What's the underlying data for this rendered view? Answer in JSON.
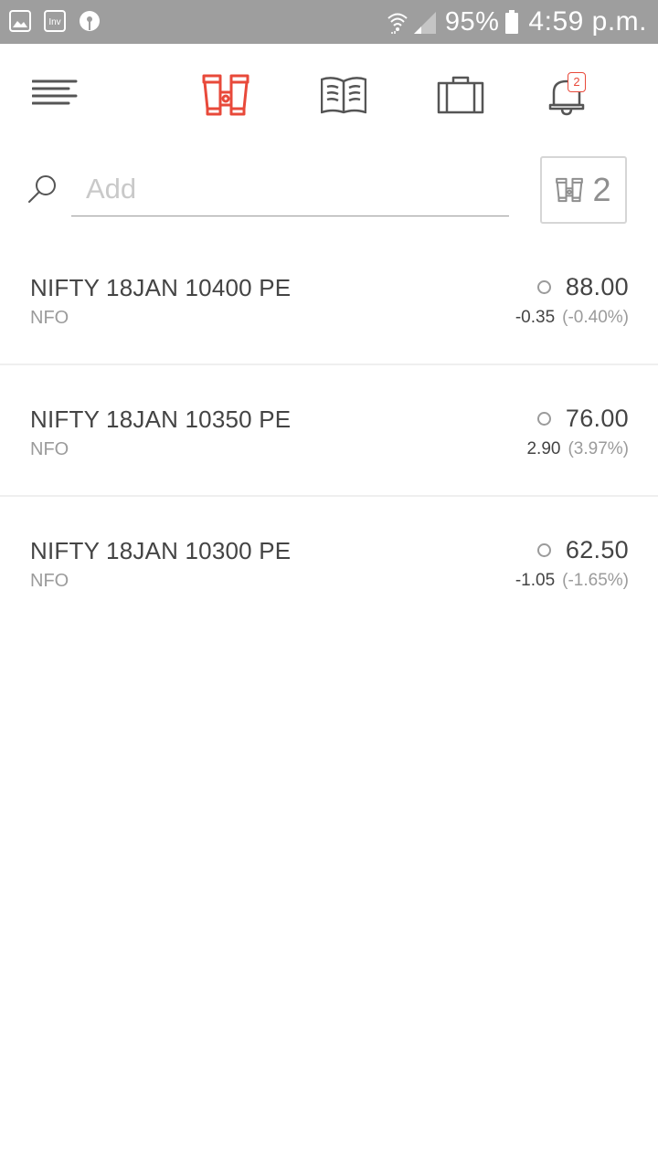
{
  "status_bar": {
    "battery_percent": "95%",
    "time": "4:59 p.m.",
    "app_badge": "Inv",
    "icons": [
      "gallery-icon",
      "inv-app-icon",
      "sbi-icon",
      "wifi-icon",
      "signal-icon",
      "battery-icon"
    ]
  },
  "nav": {
    "accent": "#e8493a",
    "icon_color": "#555555",
    "items": [
      {
        "name": "menu",
        "icon": "hamburger-icon"
      },
      {
        "name": "marketwatch",
        "icon": "binoculars-icon",
        "active": true
      },
      {
        "name": "orders",
        "icon": "book-icon"
      },
      {
        "name": "portfolio",
        "icon": "briefcase-icon"
      },
      {
        "name": "notifications",
        "icon": "bell-icon"
      }
    ],
    "notification_count": "2"
  },
  "search": {
    "placeholder": "Add",
    "value": ""
  },
  "watchlist_switch": {
    "number": "2",
    "icon": "binoculars-icon"
  },
  "instruments": [
    {
      "symbol": "NIFTY 18JAN 10400 PE",
      "exchange": "NFO",
      "ltp": "88.00",
      "change": "-0.35",
      "change_pct": "(-0.40%)"
    },
    {
      "symbol": "NIFTY 18JAN 10350 PE",
      "exchange": "NFO",
      "ltp": "76.00",
      "change": "2.90",
      "change_pct": "(3.97%)"
    },
    {
      "symbol": "NIFTY 18JAN 10300 PE",
      "exchange": "NFO",
      "ltp": "62.50",
      "change": "-1.05",
      "change_pct": "(-1.65%)"
    }
  ]
}
